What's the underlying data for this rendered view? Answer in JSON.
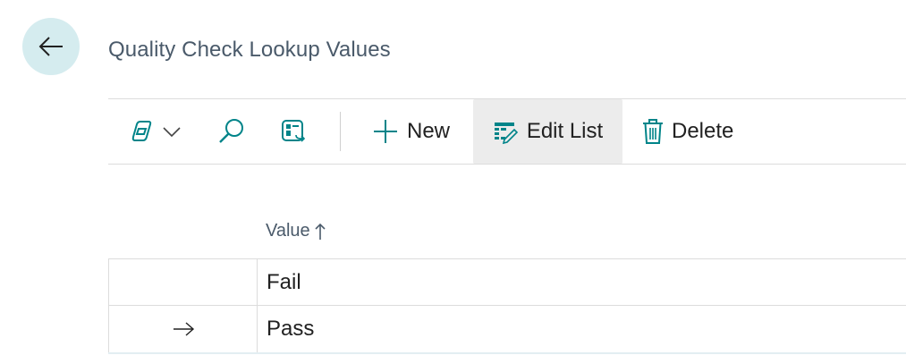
{
  "page": {
    "title": "Quality Check Lookup Values"
  },
  "toolbar": {
    "new_label": "New",
    "edit_list_label": "Edit List",
    "delete_label": "Delete"
  },
  "table": {
    "column_header": "Value",
    "rows": [
      {
        "value": "Fail",
        "current": false
      },
      {
        "value": "Pass",
        "current": true
      }
    ]
  },
  "colors": {
    "accent": "#008489",
    "back_button_bg": "#d5ecef"
  },
  "icons": {
    "back": "arrow-left-icon",
    "copilot": "copilot-icon",
    "dropdown": "chevron-down-icon",
    "search": "search-icon",
    "filter_pane": "filter-pane-icon",
    "new": "plus-icon",
    "edit_list": "edit-list-icon",
    "delete": "trash-icon",
    "sort": "sort-ascending-icon",
    "current_row": "arrow-right-icon"
  }
}
